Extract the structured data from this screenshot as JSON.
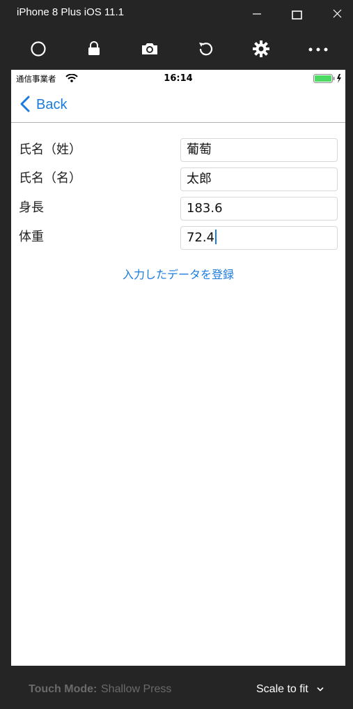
{
  "window": {
    "title": "iPhone 8 Plus iOS 11.1"
  },
  "toolbar": {
    "icons": [
      "home-button-icon",
      "lock-icon",
      "camera-icon",
      "rotate-icon",
      "gear-icon",
      "more-icon"
    ]
  },
  "status_bar": {
    "carrier": "通信事業者",
    "time": "16:14"
  },
  "nav": {
    "back_label": "Back"
  },
  "form": {
    "fields": [
      {
        "label": "氏名（姓）",
        "value": "葡萄"
      },
      {
        "label": "氏名（名）",
        "value": "太郎"
      },
      {
        "label": "身長",
        "value": "183.6"
      },
      {
        "label": "体重",
        "value": "72.4"
      }
    ],
    "register_label": "入力したデータを登録"
  },
  "footer": {
    "touch_mode_label": "Touch Mode:",
    "touch_mode_value": "Shallow Press",
    "scale_label": "Scale to fit"
  },
  "colors": {
    "accent": "#1a7bdd",
    "chrome_bg": "#252526",
    "battery": "#4cd964"
  }
}
